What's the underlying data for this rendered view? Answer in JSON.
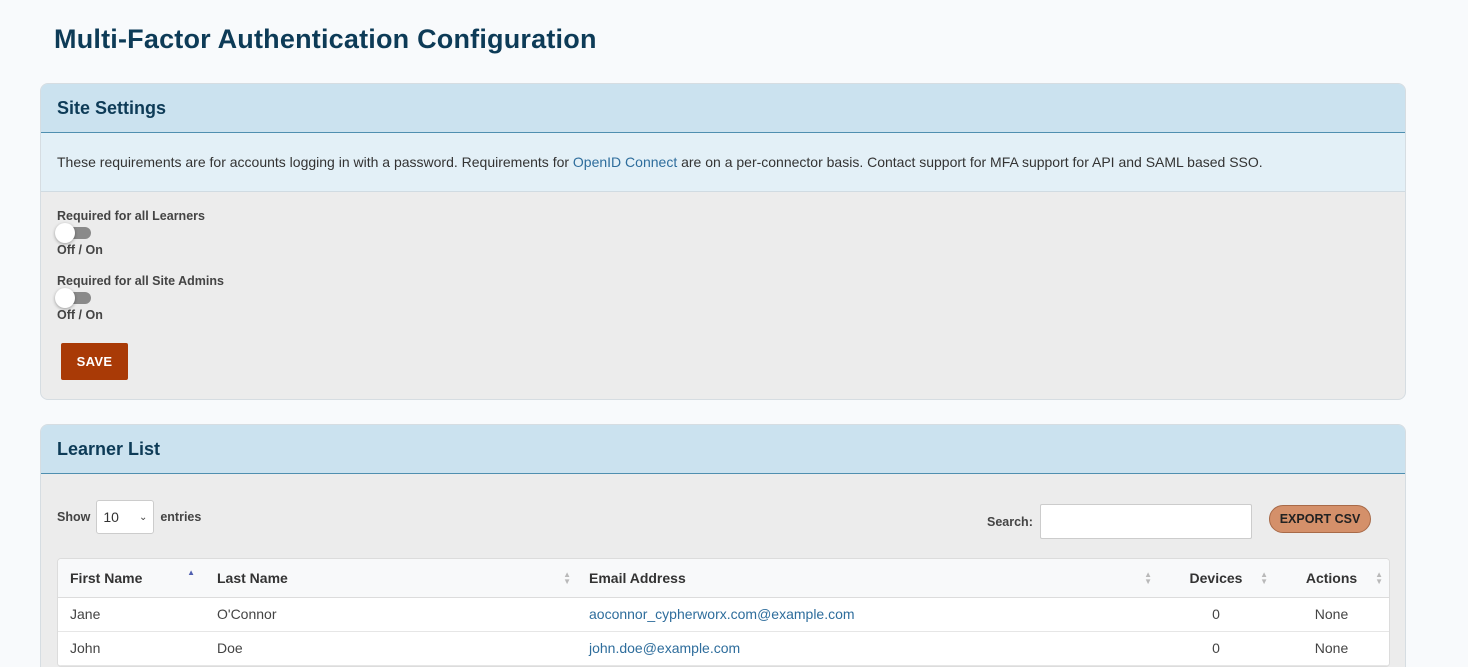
{
  "page": {
    "title": "Multi-Factor Authentication Configuration"
  },
  "site_settings": {
    "heading": "Site Settings",
    "info_prefix": "These requirements are for accounts logging in with a password. Requirements for ",
    "info_link": "OpenID Connect",
    "info_suffix": " are on a per-connector basis. Contact support for MFA support for API and SAML based SSO.",
    "toggles": [
      {
        "label": "Required for all Learners",
        "state_label": "Off / On",
        "checked": false
      },
      {
        "label": "Required for all Site Admins",
        "state_label": "Off / On",
        "checked": false
      }
    ],
    "save_label": "SAVE",
    "save_color": "#a93a06"
  },
  "learner_list": {
    "heading": "Learner List",
    "show_label": "Show",
    "entries_value": "10",
    "entries_label": "entries",
    "search_label": "Search:",
    "search_value": "",
    "export_label": "EXPORT CSV",
    "columns": [
      "First Name",
      "Last Name",
      "Email Address",
      "Devices",
      "Actions"
    ],
    "sort_column": "First Name",
    "sort_direction": "ascending",
    "rows": [
      {
        "first": "Jane",
        "last": "O'Connor",
        "email": "aoconnor_cypherworx.com@example.com",
        "devices": "0",
        "actions": "None"
      },
      {
        "first": "John",
        "last": "Doe",
        "email": "john.doe@example.com",
        "devices": "0",
        "actions": "None"
      }
    ]
  },
  "colors": {
    "title": "#0d3b57",
    "panel_header": "#cbe2ef",
    "link": "#2e6d9c"
  }
}
